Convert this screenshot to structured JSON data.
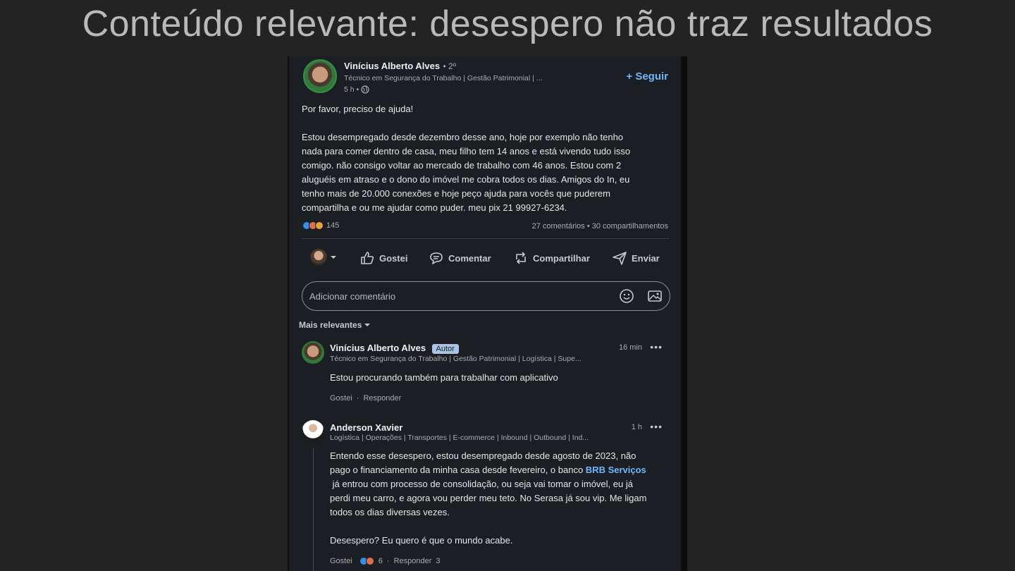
{
  "slide": {
    "title": "Conteúdo relevante: desespero não traz resultados"
  },
  "post": {
    "author": "Vinícius Alberto Alves",
    "degree": "• 2º",
    "headline": "Técnico em Segurança do Trabalho | Gestão Patrimonial | ...",
    "time": "5 h •",
    "follow_label": "+ Seguir",
    "text": [
      "Por favor, preciso de ajuda!",
      "",
      "Estou desempregado desde dezembro desse ano, hoje por exemplo não tenho",
      "nada para comer dentro de casa, meu filho tem 14 anos e está vivendo tudo isso",
      "comigo. não consigo voltar ao mercado de trabalho com 46 anos. Estou com 2",
      "aluguéis em atraso e o dono do imóvel me cobra todos os dias. Amigos do In, eu",
      "tenho mais de 20.000 conexões e hoje peço ajuda para vocês que puderem",
      "compartilha e ou me ajudar como puder. meu pix 21 99927-6234."
    ],
    "reaction_count": "145",
    "stats": "27 comentários • 30 compartilhamentos"
  },
  "actions": {
    "like": "Gostei",
    "comment": "Comentar",
    "share": "Compartilhar",
    "send": "Enviar"
  },
  "comment_input": {
    "placeholder": "Adicionar comentário"
  },
  "sort": {
    "label": "Mais relevantes"
  },
  "comments": [
    {
      "author": "Vinícius Alberto Alves",
      "badge": "Autor",
      "headline": "Técnico em Segurança do Trabalho | Gestão Patrimonial | Logística | Supe...",
      "time": "16 min",
      "text": "Estou procurando também para trabalhar com aplicativo",
      "like": "Gostei",
      "sep": "·",
      "reply": "Responder"
    },
    {
      "author": "Anderson Xavier",
      "headline": "Logística | Operações | Transportes | E-commerce | Inbound | Outbound | Ind...",
      "time": "1 h",
      "text_lines": [
        "Entendo esse desespero, estou desempregado desde agosto de 2023, não",
        "pago o financiamento da minha casa desde fevereiro, o banco ",
        " já entrou com processo de consolidação, ou seja vai tomar o imóvel, eu já",
        "perdi meu carro, e agora vou perder meu teto. No Serasa já sou vip. Me ligam",
        "todos os dias diversas vezes.",
        "",
        "Desespero? Eu quero é que o mundo acabe."
      ],
      "mention": "BRB Serviços",
      "like": "Gostei",
      "reactions": "6",
      "sep": "·",
      "reply": "Responder",
      "reply_count": "3"
    }
  ],
  "colors": {
    "background": "#232323",
    "panel": "#1b1f23",
    "accent": "#71b7fb",
    "badge": "#a8c3e3"
  }
}
